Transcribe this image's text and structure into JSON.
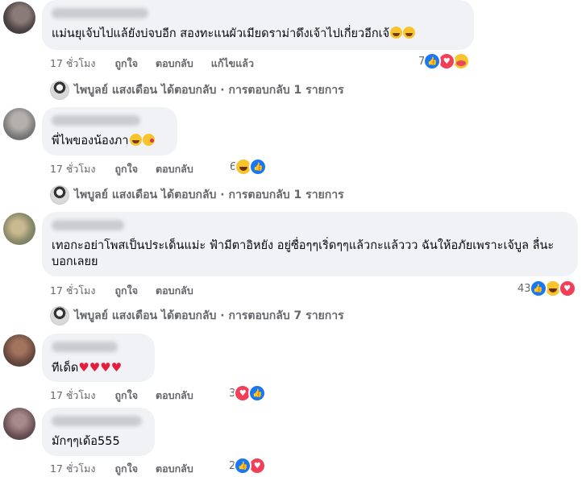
{
  "comments": [
    {
      "text": "แม่นยุเจ้บไปแล้ยังบ่จบอีก สองทะแนผัวเมียดราม่าดึงเจ้าไปเกี่ยวอีกเจ้",
      "emojis": [
        "rolling-laughing-emoji",
        "rolling-laughing-emoji"
      ],
      "time": "17 ชั่วโมง",
      "like": "ถูกใจ",
      "reply": "ตอบกลับ",
      "edited": "แก้ไขแล้ว",
      "reaction_count": "7",
      "reactions": [
        "like",
        "love",
        "care"
      ]
    },
    {
      "text": "พี่ไพของน้องภา",
      "emojis": [
        "rolling-laughing-emoji",
        "kissing-emoji"
      ],
      "time": "17 ชั่วโมง",
      "like": "ถูกใจ",
      "reply": "ตอบกลับ",
      "reaction_count": "6",
      "reactions": [
        "haha",
        "like"
      ]
    },
    {
      "text": "เทอกะอย่าโพสเป็นประเด็นแม่ะ ฟ้ามีตาอิหยัง อยู่ซื่อๆๆเริ่ดๆๆแล้วกะแล้ววว ฉันให้อภัยเพราะเจ้บูล ลื่นะบอกเลยย",
      "time": "17 ชั่วโมง",
      "like": "ถูกใจ",
      "reply": "ตอบกลับ",
      "reaction_count": "43",
      "reactions": [
        "like",
        "haha",
        "love"
      ]
    },
    {
      "text": "ทีเด็ด",
      "hearts": "♥♥♥♥",
      "time": "17 ชั่วโมง",
      "like": "ถูกใจ",
      "reply": "ตอบกลับ",
      "reaction_count": "3",
      "reactions": [
        "love",
        "like"
      ]
    },
    {
      "text": "มักๆๆเด้อ555",
      "time": "17 ชั่วโมง",
      "like": "ถูกใจ",
      "reply": "ตอบกลับ",
      "reaction_count": "2",
      "reactions": [
        "like",
        "love"
      ]
    }
  ],
  "replies": [
    {
      "name": "ไพบูลย์ แสงเดือน",
      "action": "ได้ตอบกลับ",
      "sep": "·",
      "count_text": "การตอบกลับ 1 รายการ"
    },
    {
      "name": "ไพบูลย์ แสงเดือน",
      "action": "ได้ตอบกลับ",
      "sep": "·",
      "count_text": "การตอบกลับ 1 รายการ"
    },
    {
      "name": "ไพบูลย์ แสงเดือน",
      "action": "ได้ตอบกลับ",
      "sep": "·",
      "count_text": "การตอบกลับ 7 รายการ"
    }
  ],
  "colors": {
    "like": "#1877f2",
    "love": "#f33e58",
    "haha": "#f7c42c",
    "muted": "#65676b",
    "bubble": "#f0f2f5"
  }
}
